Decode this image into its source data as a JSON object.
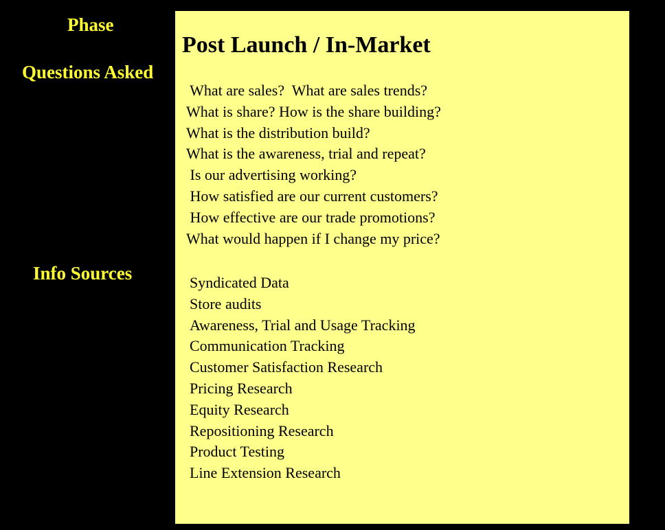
{
  "sidebar": {
    "phase_label": "Phase",
    "questions_label": "Questions Asked",
    "info_sources_label": "Info Sources"
  },
  "panel": {
    "title": "Post Launch / In-Market",
    "questions": [
      " What are sales?  What are sales trends?",
      "What is share? How is the share building?",
      "What is the distribution build?",
      "What is the awareness, trial and repeat?",
      " Is our advertising working?",
      " How satisfied are our current customers?",
      " How effective are our trade promotions?",
      "What would happen if I change my price?"
    ],
    "sources": [
      "Syndicated Data",
      "Store audits",
      "Awareness, Trial and Usage Tracking",
      "Communication Tracking",
      "Customer Satisfaction Research",
      "Pricing Research",
      "Equity Research",
      "Repositioning Research",
      "Product Testing",
      "Line Extension Research"
    ]
  },
  "colors": {
    "background": "#000000",
    "label_yellow": "#ffff33",
    "panel_fill": "#ffff8c"
  }
}
